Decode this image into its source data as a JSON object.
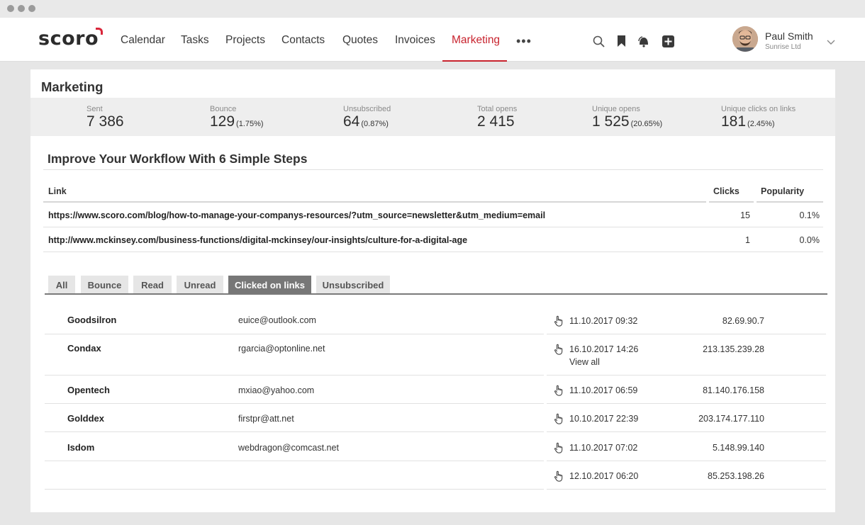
{
  "app": {
    "brand": "scoro"
  },
  "nav": {
    "items": [
      "Calendar",
      "Tasks",
      "Projects",
      "Contacts",
      "Quotes",
      "Invoices",
      "Marketing"
    ],
    "more": "•••",
    "active": "Marketing"
  },
  "toolbar": {
    "icons": [
      "search-icon",
      "bookmark-icon",
      "notifications-icon",
      "add-icon"
    ]
  },
  "user": {
    "name": "Paul Smith",
    "company": "Sunrise Ltd"
  },
  "page": {
    "title": "Marketing"
  },
  "stats": [
    {
      "label": "Sent",
      "value": "7 386",
      "pct": ""
    },
    {
      "label": "Bounce",
      "value": "129",
      "pct": "(1.75%)"
    },
    {
      "label": "Unsubscribed",
      "value": "64",
      "pct": "(0.87%)"
    },
    {
      "label": "Total opens",
      "value": "2 415",
      "pct": ""
    },
    {
      "label": "Unique opens",
      "value": "1 525",
      "pct": "(20.65%)"
    },
    {
      "label": "Unique clicks on links",
      "value": "181",
      "pct": "(2.45%)"
    }
  ],
  "campaign": {
    "title": "Improve Your Workflow With 6 Simple Steps"
  },
  "links_table": {
    "headers": {
      "link": "Link",
      "clicks": "Clicks",
      "popularity": "Popularity"
    },
    "rows": [
      {
        "link": "https://www.scoro.com/blog/how-to-manage-your-companys-resources/?utm_source=newsletter&utm_medium=email",
        "clicks": "15",
        "popularity": "0.1%"
      },
      {
        "link": "http://www.mckinsey.com/business-functions/digital-mckinsey/our-insights/culture-for-a-digital-age",
        "clicks": "1",
        "popularity": "0.0%"
      }
    ]
  },
  "tabs": {
    "items": [
      "All",
      "Bounce",
      "Read",
      "Unread",
      "Clicked on links",
      "Unsubscribed"
    ],
    "active": "Clicked on links"
  },
  "recipients": [
    {
      "name": "Goodsilron",
      "email": "euice@outlook.com",
      "date": "11.10.2017 09:32",
      "extra": "",
      "ip": "82.69.90.7"
    },
    {
      "name": "Condax",
      "email": "rgarcia@optonline.net",
      "date": "16.10.2017 14:26",
      "extra": "View all",
      "ip": "213.135.239.28"
    },
    {
      "name": "Opentech",
      "email": "mxiao@yahoo.com",
      "date": "11.10.2017 06:59",
      "extra": "",
      "ip": "81.140.176.158"
    },
    {
      "name": "Golddex",
      "email": "firstpr@att.net",
      "date": "10.10.2017 22:39",
      "extra": "",
      "ip": "203.174.177.110"
    },
    {
      "name": "Isdom",
      "email": "webdragon@comcast.net",
      "date": "11.10.2017 07:02",
      "extra": "",
      "ip": "5.148.99.140"
    },
    {
      "name": "",
      "email": "",
      "date": "12.10.2017 06:20",
      "extra": "",
      "ip": "85.253.198.26"
    }
  ],
  "colors": {
    "accent": "#c8232e",
    "tab_active": "#777777",
    "stats_bg": "#eeeeee"
  }
}
